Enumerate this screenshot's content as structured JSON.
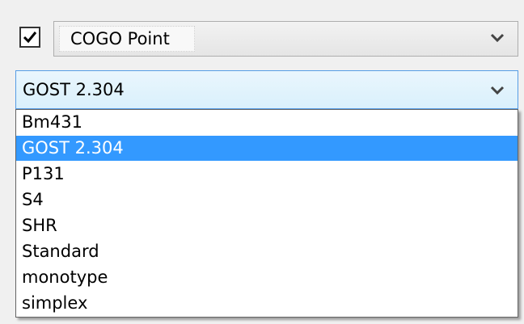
{
  "object_type": {
    "checked": true,
    "value": "COGO Point"
  },
  "font_style": {
    "value": "GOST 2.304",
    "options": [
      {
        "label": "Bm431",
        "selected": false
      },
      {
        "label": "GOST 2.304",
        "selected": true
      },
      {
        "label": "P131",
        "selected": false
      },
      {
        "label": "S4",
        "selected": false
      },
      {
        "label": "SHR",
        "selected": false
      },
      {
        "label": "Standard",
        "selected": false
      },
      {
        "label": "monotype",
        "selected": false
      },
      {
        "label": "simplex",
        "selected": false
      }
    ]
  },
  "colors": {
    "highlight": "#3399ff",
    "focus_border": "#569de5"
  },
  "icons": {
    "checkbox": "checkmark-icon",
    "dropdown": "chevron-down-icon"
  }
}
